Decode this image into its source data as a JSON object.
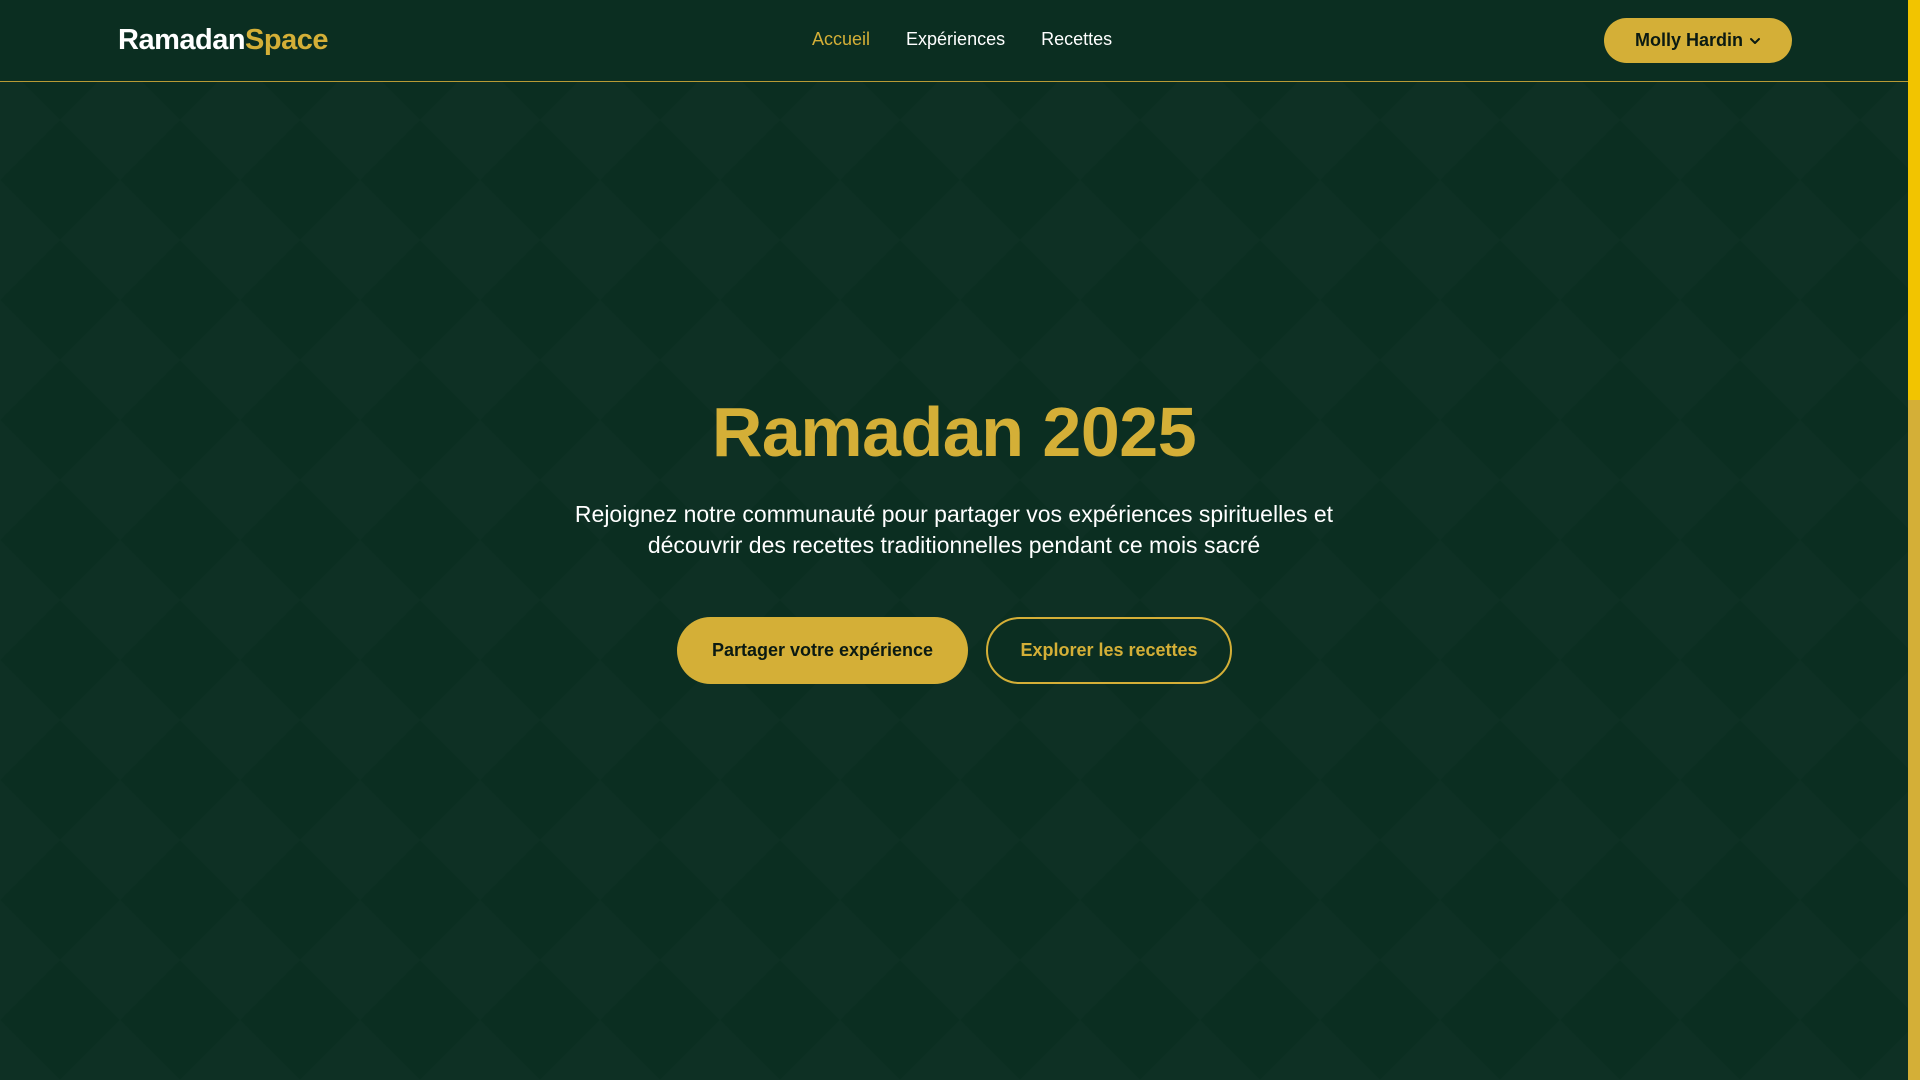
{
  "brand": {
    "name_main": "Ramadan",
    "name_accent": "Space"
  },
  "nav": {
    "items": [
      {
        "label": "Accueil",
        "active": true
      },
      {
        "label": "Expériences",
        "active": false
      },
      {
        "label": "Recettes",
        "active": false
      }
    ]
  },
  "user": {
    "name": "Molly Hardin",
    "icon": "chevron-down-icon"
  },
  "hero": {
    "title": "Ramadan 2025",
    "subtitle_line1": "Rejoignez notre communauté pour partager vos expériences spirituelles et",
    "subtitle_line2": "découvrir des recettes traditionnelles pendant ce mois sacré",
    "primary_button": "Partager votre expérience",
    "secondary_button": "Explorer les recettes"
  },
  "colors": {
    "background": "#0b2e21",
    "accent": "#d4af37",
    "text": "#ffffff"
  }
}
